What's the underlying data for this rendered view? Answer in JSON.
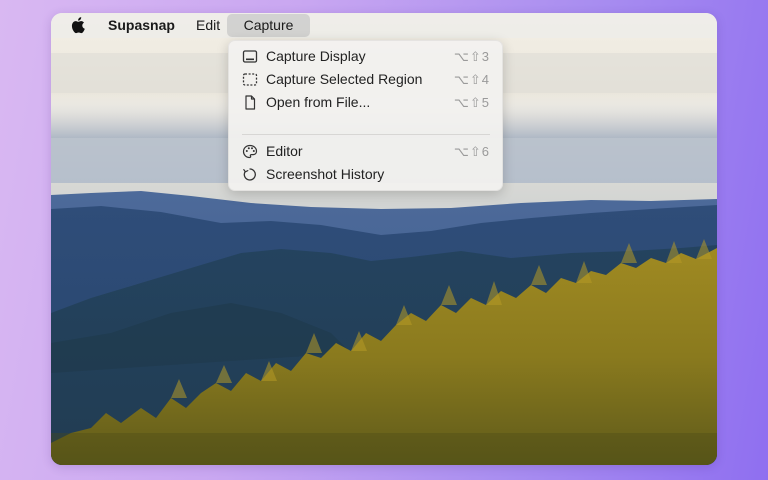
{
  "menubar": {
    "app_name": "Supasnap",
    "menus": [
      "Edit",
      "Capture"
    ],
    "active_menu": "Capture"
  },
  "capture_menu": {
    "items": [
      {
        "label": "Capture Display",
        "shortcut": "⌥⇧3",
        "icon": "display-icon"
      },
      {
        "label": "Capture Selected Region",
        "shortcut": "⌥⇧4",
        "icon": "dashed-rectangle-icon"
      },
      {
        "label": "Open from File...",
        "shortcut": "⌥⇧5",
        "icon": "document-icon"
      },
      {
        "label": "Editor",
        "shortcut": "⌥⇧6",
        "icon": "palette-icon"
      },
      {
        "label": "Screenshot History",
        "shortcut": "",
        "icon": "history-icon"
      }
    ]
  },
  "colors": {
    "background_gradient_start": "#d9b8f2",
    "background_gradient_end": "#8f6ff0",
    "menubar": "#eeece9",
    "active_menu_highlight": "#c8c8c8",
    "shortcut_text": "#9a9a9a"
  }
}
